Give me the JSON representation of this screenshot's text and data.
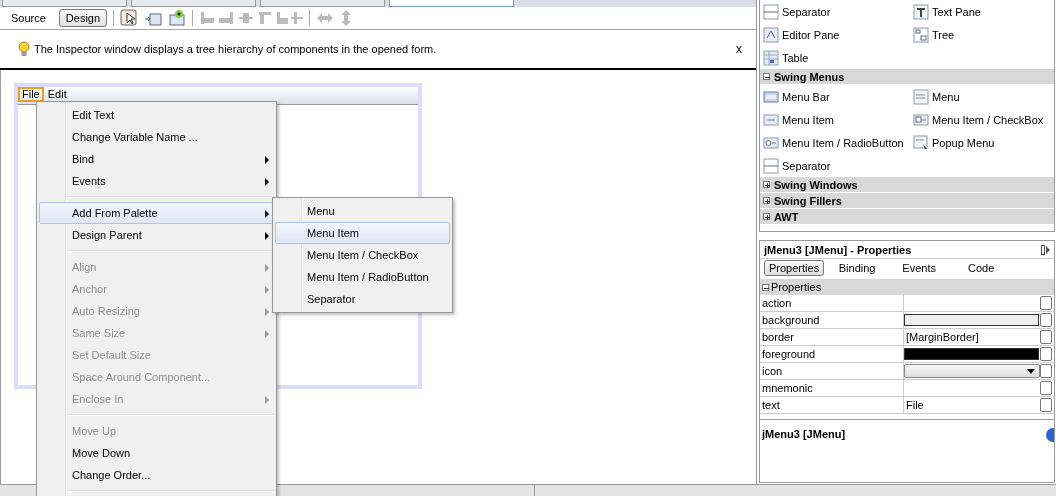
{
  "editor_tabs": [
    {
      "selected": false
    },
    {
      "selected": false
    },
    {
      "selected": false
    },
    {
      "selected": true
    }
  ],
  "view_toggle": [
    {
      "label": "Source",
      "selected": false
    },
    {
      "label": "Design",
      "selected": true
    }
  ],
  "info_bar": {
    "message": "The Inspector window displays a tree hierarchy of components in the opened form.",
    "close": "x"
  },
  "form": {
    "menus": [
      {
        "label": "File",
        "selected": true
      },
      {
        "label": "Edit",
        "selected": false
      }
    ]
  },
  "context_menu": [
    {
      "kind": "item",
      "label": "Edit Text",
      "disabled": false,
      "submenu": false,
      "highlighted": false
    },
    {
      "kind": "item",
      "label": "Change Variable Name ...",
      "disabled": false,
      "submenu": false,
      "highlighted": false
    },
    {
      "kind": "item",
      "label": "Bind",
      "disabled": false,
      "submenu": true,
      "highlighted": false
    },
    {
      "kind": "item",
      "label": "Events",
      "disabled": false,
      "submenu": true,
      "highlighted": false
    },
    {
      "kind": "separator"
    },
    {
      "kind": "item",
      "label": "Add From Palette",
      "disabled": false,
      "submenu": true,
      "highlighted": true
    },
    {
      "kind": "item",
      "label": "Design Parent",
      "disabled": false,
      "submenu": true,
      "highlighted": false
    },
    {
      "kind": "separator"
    },
    {
      "kind": "item",
      "label": "Align",
      "disabled": true,
      "submenu": true,
      "highlighted": false
    },
    {
      "kind": "item",
      "label": "Anchor",
      "disabled": true,
      "submenu": true,
      "highlighted": false
    },
    {
      "kind": "item",
      "label": "Auto Resizing",
      "disabled": true,
      "submenu": true,
      "highlighted": false
    },
    {
      "kind": "item",
      "label": "Same Size",
      "disabled": true,
      "submenu": true,
      "highlighted": false
    },
    {
      "kind": "item",
      "label": "Set Default Size",
      "disabled": true,
      "submenu": false,
      "highlighted": false
    },
    {
      "kind": "item",
      "label": "Space Around Component...",
      "disabled": true,
      "submenu": false,
      "highlighted": false
    },
    {
      "kind": "item",
      "label": "Enclose In",
      "disabled": true,
      "submenu": true,
      "highlighted": false
    },
    {
      "kind": "separator"
    },
    {
      "kind": "item",
      "label": "Move Up",
      "disabled": true,
      "submenu": false,
      "highlighted": false
    },
    {
      "kind": "item",
      "label": "Move Down",
      "disabled": false,
      "submenu": false,
      "highlighted": false
    },
    {
      "kind": "item",
      "label": "Change Order...",
      "disabled": false,
      "submenu": false,
      "highlighted": false
    },
    {
      "kind": "separator"
    }
  ],
  "submenu": [
    {
      "label": "Menu",
      "highlighted": false
    },
    {
      "label": "Menu Item",
      "highlighted": true
    },
    {
      "label": "Menu Item / CheckBox",
      "highlighted": false
    },
    {
      "label": "Menu Item / RadioButton",
      "highlighted": false
    },
    {
      "label": "Separator",
      "highlighted": false
    }
  ],
  "palette": {
    "items": [
      "Separator",
      "Text Pane",
      "Editor Pane",
      "Tree",
      "Table"
    ],
    "categories": [
      {
        "label": "Swing Menus",
        "expanded": true,
        "items": [
          "Menu Bar",
          "Menu",
          "Menu Item",
          "Menu Item / CheckBox",
          "Menu Item / RadioButton",
          "Popup Menu",
          "Separator"
        ]
      },
      {
        "label": "Swing Windows",
        "expanded": false
      },
      {
        "label": "Swing Fillers",
        "expanded": false
      },
      {
        "label": "AWT",
        "expanded": false
      }
    ]
  },
  "properties": {
    "title": "jMenu3 [JMenu] - Properties",
    "tabs": [
      {
        "label": "Properties",
        "selected": true
      },
      {
        "label": "Binding",
        "selected": false
      },
      {
        "label": "Events",
        "selected": false
      },
      {
        "label": "Code",
        "selected": false
      }
    ],
    "section": "Properties",
    "rows": [
      {
        "name": "action",
        "kind": "empty"
      },
      {
        "name": "background",
        "kind": "color",
        "color": "#eeeeee"
      },
      {
        "name": "border",
        "kind": "text",
        "value": "[MarginBorder]"
      },
      {
        "name": "foreground",
        "kind": "color",
        "color": "#000000"
      },
      {
        "name": "icon",
        "kind": "combo"
      },
      {
        "name": "mnemonic",
        "kind": "empty"
      },
      {
        "name": "text",
        "kind": "text",
        "value": "File"
      }
    ],
    "footer": "jMenu3 [JMenu]"
  }
}
